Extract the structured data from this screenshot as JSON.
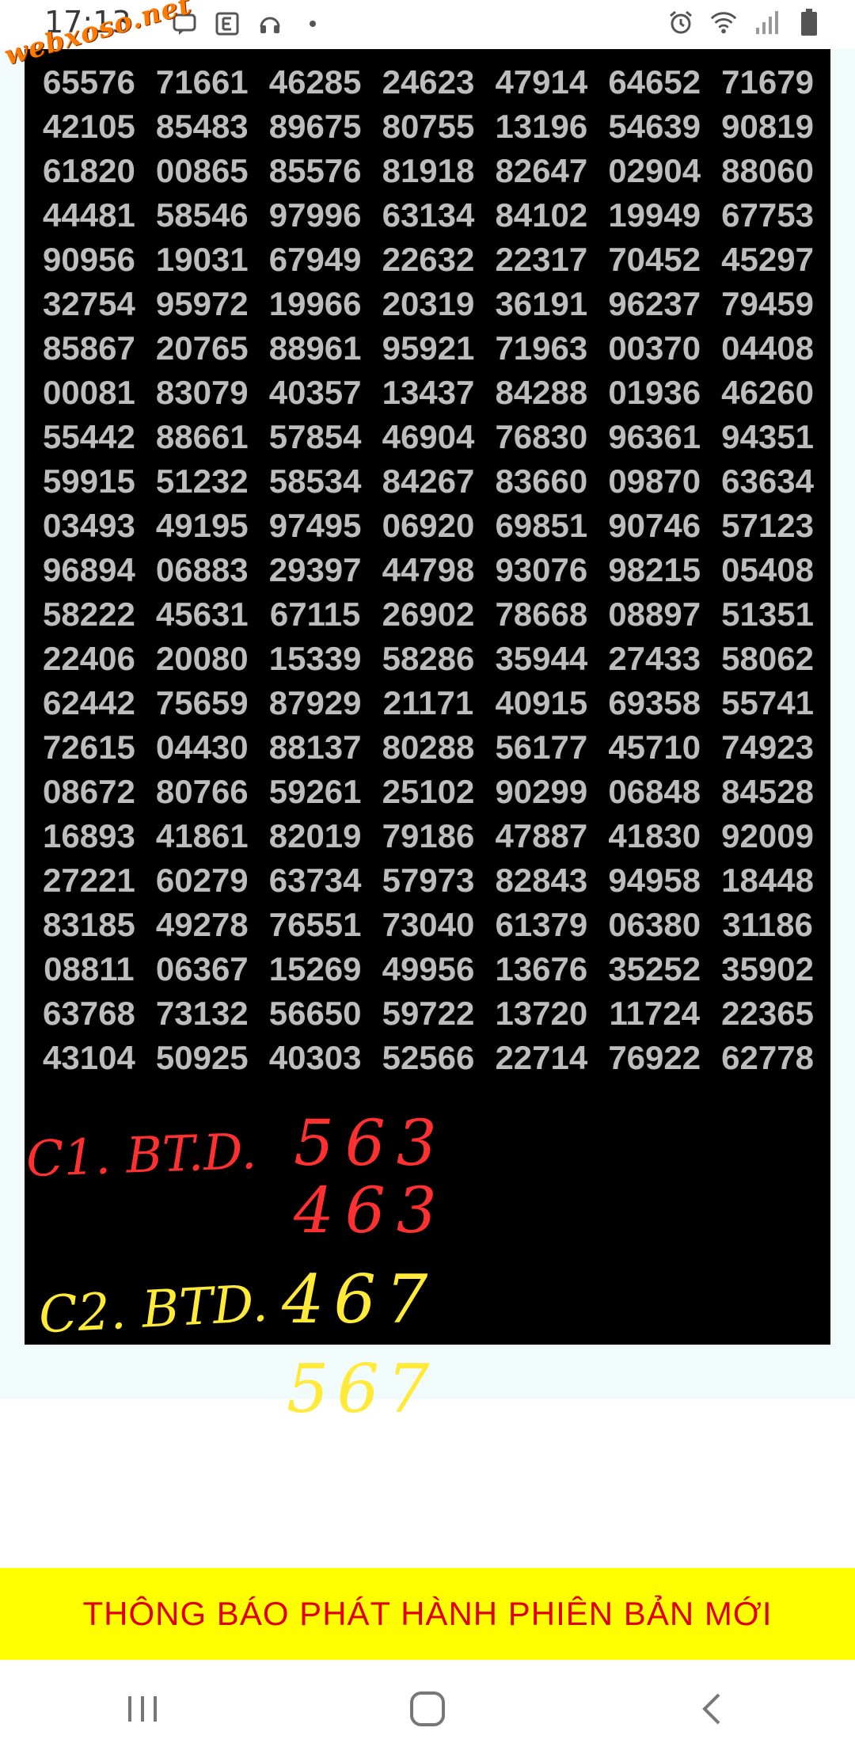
{
  "status_bar": {
    "time": "17:13",
    "left_icons": [
      "message-icon",
      "e-app-icon",
      "headset-icon",
      "notification-dot-icon"
    ],
    "right_icons": [
      "alarm-icon",
      "wifi-icon",
      "signal-icon",
      "battery-icon"
    ]
  },
  "watermark": "webxoso.net",
  "numbers": [
    [
      "65576",
      "71661",
      "46285",
      "24623",
      "47914",
      "64652",
      "71679"
    ],
    [
      "42105",
      "85483",
      "89675",
      "80755",
      "13196",
      "54639",
      "90819"
    ],
    [
      "61820",
      "00865",
      "85576",
      "81918",
      "82647",
      "02904",
      "88060"
    ],
    [
      "44481",
      "58546",
      "97996",
      "63134",
      "84102",
      "19949",
      "67753"
    ],
    [
      "90956",
      "19031",
      "67949",
      "22632",
      "22317",
      "70452",
      "45297"
    ],
    [
      "32754",
      "95972",
      "19966",
      "20319",
      "36191",
      "96237",
      "79459"
    ],
    [
      "85867",
      "20765",
      "88961",
      "95921",
      "71963",
      "00370",
      "04408"
    ],
    [
      "00081",
      "83079",
      "40357",
      "13437",
      "84288",
      "01936",
      "46260"
    ],
    [
      "55442",
      "88661",
      "57854",
      "46904",
      "76830",
      "96361",
      "94351"
    ],
    [
      "59915",
      "51232",
      "58534",
      "84267",
      "83660",
      "09870",
      "63634"
    ],
    [
      "03493",
      "49195",
      "97495",
      "06920",
      "69851",
      "90746",
      "57123"
    ],
    [
      "96894",
      "06883",
      "29397",
      "44798",
      "93076",
      "98215",
      "05408"
    ],
    [
      "58222",
      "45631",
      "67115",
      "26902",
      "78668",
      "08897",
      "51351"
    ],
    [
      "22406",
      "20080",
      "15339",
      "58286",
      "35944",
      "27433",
      "58062"
    ],
    [
      "62442",
      "75659",
      "87929",
      "21171",
      "40915",
      "69358",
      "55741"
    ],
    [
      "72615",
      "04430",
      "88137",
      "80288",
      "56177",
      "45710",
      "74923"
    ],
    [
      "08672",
      "80766",
      "59261",
      "25102",
      "90299",
      "06848",
      "84528"
    ],
    [
      "16893",
      "41861",
      "82019",
      "79186",
      "47887",
      "41830",
      "92009"
    ],
    [
      "27221",
      "60279",
      "63734",
      "57973",
      "82843",
      "94958",
      "18448"
    ],
    [
      "83185",
      "49278",
      "76551",
      "73040",
      "61379",
      "06380",
      "31186"
    ],
    [
      "08811",
      "06367",
      "15269",
      "49956",
      "13676",
      "35252",
      "35902"
    ],
    [
      "63768",
      "73132",
      "56650",
      "59722",
      "13720",
      "11724",
      "22365"
    ],
    [
      "43104",
      "50925",
      "40303",
      "52566",
      "22714",
      "76922",
      "62778"
    ]
  ],
  "handwriting": {
    "c1_label": "C1. BT.D.",
    "c1_line1": "563",
    "c1_line2": "463",
    "c2_label": "C2. BTD.",
    "c2_line1": "467",
    "c2_line2": "567"
  },
  "banner": {
    "text": "THÔNG BÁO PHÁT HÀNH PHIÊN BẢN MỚI"
  },
  "colors": {
    "panel": "#000000",
    "digits": "#bdbdbd",
    "banner_bg": "#ffff00",
    "banner_text": "#e00000",
    "hand_red": "#ff3030",
    "hand_yellow": "#ffea3a"
  }
}
